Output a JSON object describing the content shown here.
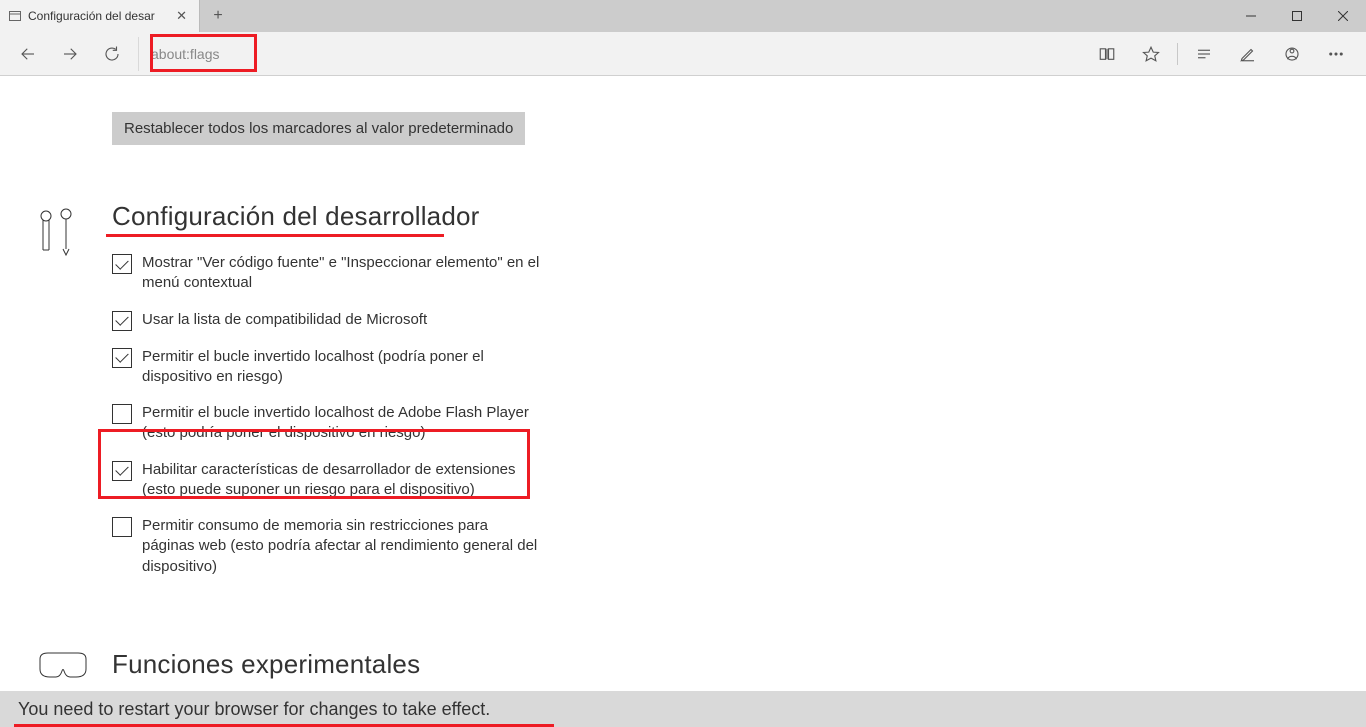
{
  "tab": {
    "title": "Configuración del desar"
  },
  "url": "about:flags",
  "reset_button": "Restablecer todos los marcadores al valor predeterminado",
  "section_dev": {
    "title": "Configuración del desarrollador",
    "options": [
      {
        "label": "Mostrar \"Ver código fuente\" e \"Inspeccionar elemento\" en el menú contextual",
        "checked": true
      },
      {
        "label": "Usar la lista de compatibilidad de Microsoft",
        "checked": true
      },
      {
        "label": "Permitir el bucle invertido localhost (podría poner el dispositivo en riesgo)",
        "checked": true
      },
      {
        "label": "Permitir el bucle invertido localhost de Adobe Flash Player (esto podría poner el dispositivo en riesgo)",
        "checked": false
      },
      {
        "label": "Habilitar características de desarrollador de extensiones (esto puede suponer un riesgo para el dispositivo)",
        "checked": true
      },
      {
        "label": "Permitir consumo de memoria sin restricciones para páginas web (esto podría afectar al rendimiento general del dispositivo)",
        "checked": false
      }
    ]
  },
  "section_exp": {
    "title": "Funciones experimentales"
  },
  "footer": "You need to restart your browser for changes to take effect.",
  "highlights": {
    "url_box": true,
    "dev_title_underline": true,
    "option_4_box": true,
    "footer_underline": true
  }
}
